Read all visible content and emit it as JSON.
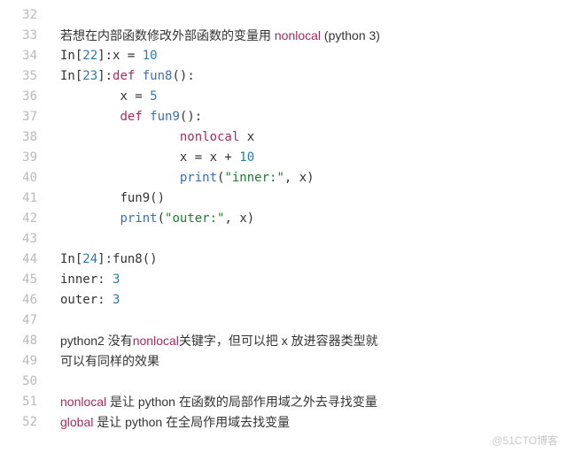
{
  "gutter": {
    "start": 32,
    "end": 52
  },
  "lines": {
    "l33": {
      "t1": "若想在内部函数修改外部函数的变量用 ",
      "kw": "nonlocal",
      "t2": " (python 3)"
    },
    "l34": {
      "prompt": "In[",
      "n": "22",
      "post": "]:x = ",
      "val": "10"
    },
    "l35": {
      "prompt": "In[",
      "n": "23",
      "post": "]:",
      "kw": "def",
      "sp": " ",
      "fn": "fun8",
      "paren": "():"
    },
    "l36": {
      "indent": "        ",
      "var": "x = ",
      "val": "5"
    },
    "l37": {
      "indent": "        ",
      "kw": "def",
      "sp": " ",
      "fn": "fun9",
      "paren": "():"
    },
    "l38": {
      "indent": "                ",
      "kw": "nonlocal",
      "rest": " x"
    },
    "l39": {
      "indent": "                ",
      "pre": "x = x + ",
      "val": "10"
    },
    "l40": {
      "indent": "                ",
      "fn": "print",
      "open": "(",
      "str": "\"inner:\"",
      "rest": ", x)"
    },
    "l41": {
      "indent": "        ",
      "call": "fun9()"
    },
    "l42": {
      "indent": "        ",
      "fn": "print",
      "open": "(",
      "str": "\"outer:\"",
      "rest": ", x)"
    },
    "l44": {
      "prompt": "In[",
      "n": "24",
      "post": "]:fun8()"
    },
    "l45": {
      "label": "inner: ",
      "val": "3"
    },
    "l46": {
      "label": "outer: ",
      "val": "3"
    },
    "l48": {
      "t1": "python2 没有",
      "kw": "nonlocal",
      "t2": "关键字，但可以把 x 放进容器类型就"
    },
    "l49": {
      "t1": "可以有同样的效果"
    },
    "l51": {
      "kw": "nonlocal",
      "t1": " 是让 python 在函数的局部作用域之外去寻找变量"
    },
    "l52": {
      "kw": "global",
      "t1": " 是让 python 在全局作用域去找变量"
    }
  },
  "watermark": "@51CTO博客"
}
